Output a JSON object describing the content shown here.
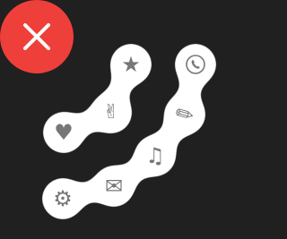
{
  "colors": {
    "background": "#202020",
    "blob": "#ffffff",
    "icon": "#777777",
    "close_button": "#ef3f3a",
    "close_icon": "#ffffff"
  },
  "close_button": {
    "icon": "close-icon"
  },
  "menu_items": [
    {
      "id": "favorite",
      "icon": "star-icon",
      "glyph": "★"
    },
    {
      "id": "peace",
      "icon": "peace-hand-icon",
      "glyph": "✌"
    },
    {
      "id": "like",
      "icon": "heart-icon",
      "glyph": "♥"
    },
    {
      "id": "settings",
      "icon": "gear-icon",
      "glyph": "⚙"
    },
    {
      "id": "mail",
      "icon": "envelope-icon",
      "glyph": "✉"
    },
    {
      "id": "music",
      "icon": "music-note-icon",
      "glyph": "♫"
    },
    {
      "id": "edit",
      "icon": "pencil-icon",
      "glyph": "✎"
    },
    {
      "id": "call",
      "icon": "phone-icon",
      "glyph": "✆"
    }
  ]
}
